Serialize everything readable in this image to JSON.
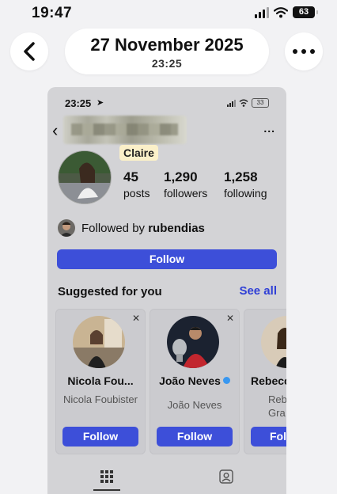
{
  "status_bar": {
    "time": "19:47",
    "battery": "63"
  },
  "header": {
    "date": "27 November 2025",
    "time": "23:25"
  },
  "screenshot": {
    "status_time": "23:25",
    "battery": "33",
    "more_label": "...",
    "name_tag": "Claire",
    "stats": [
      {
        "value": "45",
        "label": "posts"
      },
      {
        "value": "1,290",
        "label": "followers"
      },
      {
        "value": "1,258",
        "label": "following"
      }
    ],
    "followed_by_prefix": "Followed by ",
    "followed_by_user": "rubendias",
    "follow_button": "Follow",
    "suggested_title": "Suggested for you",
    "see_all": "See all",
    "suggestions": [
      {
        "name": "Nicola Fou...",
        "subtitle": "Nicola Foubister",
        "button": "Follow"
      },
      {
        "name": "João Neves",
        "subtitle": "João Neves",
        "button": "Follow"
      },
      {
        "name": "Rebecc",
        "subtitle": "Rebe Gra",
        "button": "Fol"
      }
    ]
  }
}
